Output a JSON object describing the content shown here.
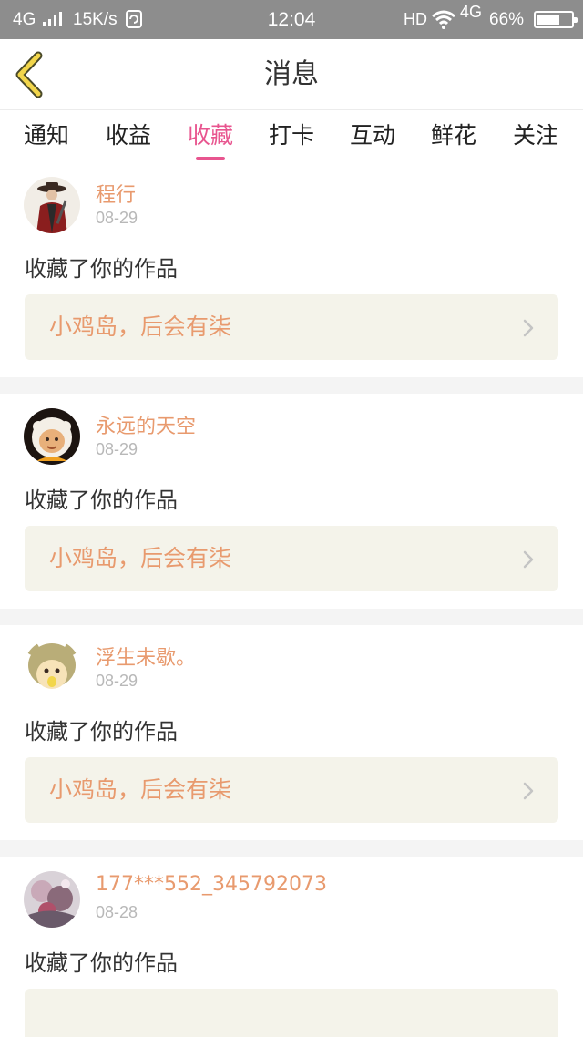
{
  "status_bar": {
    "network": "4G",
    "speed": "15K/s",
    "time": "12:04",
    "hd": "HD",
    "data_type": "4G",
    "battery_percent": "66%",
    "battery_level": 0.66
  },
  "header": {
    "title": "消息",
    "back_icon": "chevron-left-icon"
  },
  "tabs": [
    {
      "label": "通知",
      "active": false
    },
    {
      "label": "收益",
      "active": false
    },
    {
      "label": "收藏",
      "active": true
    },
    {
      "label": "打卡",
      "active": false
    },
    {
      "label": "互动",
      "active": false
    },
    {
      "label": "鲜花",
      "active": false
    },
    {
      "label": "关注",
      "active": false
    }
  ],
  "messages": [
    {
      "username": "程行",
      "date": "08-29",
      "action": "收藏了你的作品",
      "work_title": "小鸡岛，后会有柒"
    },
    {
      "username": "永远的天空",
      "date": "08-29",
      "action": "收藏了你的作品",
      "work_title": "小鸡岛，后会有柒"
    },
    {
      "username": "浮生未歇。",
      "date": "08-29",
      "action": "收藏了你的作品",
      "work_title": "小鸡岛，后会有柒"
    },
    {
      "username": "177***552_345792073",
      "date": "08-28",
      "action": "收藏了你的作品",
      "work_title": ""
    }
  ],
  "colors": {
    "accent": "#e8558f",
    "username": "#e89a6e",
    "work_box_bg": "#f4f3ea",
    "back_arrow": "#f2d64b"
  }
}
